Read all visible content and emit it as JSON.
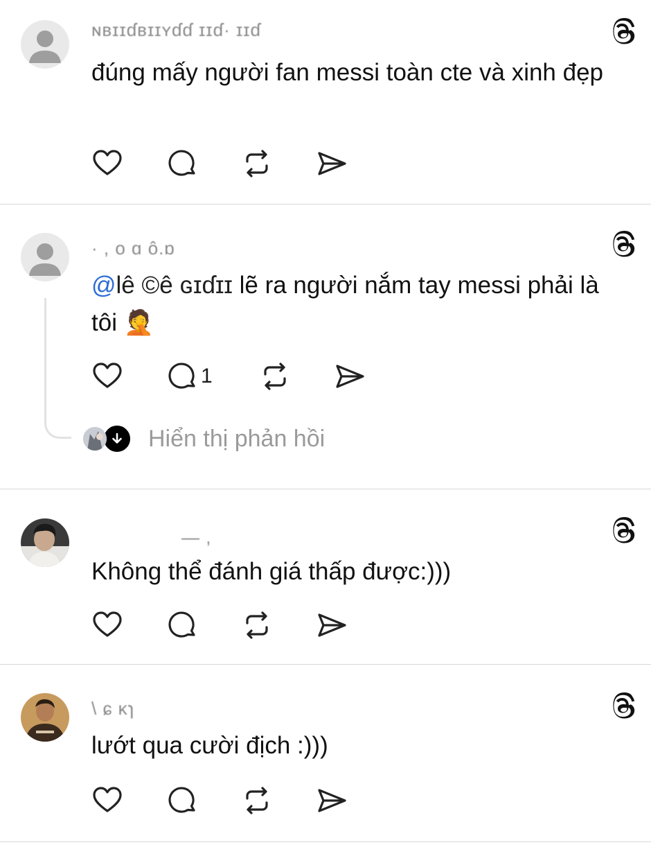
{
  "posts": [
    {
      "username": "ɴʙɪɪɗʙɪɪʏɗɗ   ɪɪɗ·        ɪɪɗ",
      "text": "đúng mấy người fan messi toàn cte và xinh đẹp",
      "avatar": "default-avatar"
    },
    {
      "username": "·  ,    o ɑ      ô.ɒ",
      "mention_at": "@",
      "mention_rest": "lê    ©ê ɢɪɗɪɪ",
      "text_after_mention": " lẽ ra người nắm tay messi phải là tôi 🤦",
      "reply_count": "1",
      "show_replies_label": "Hiển thị phản hồi",
      "avatar": "default-avatar"
    },
    {
      "username": "—   ,",
      "text": "Không thể đánh giá thấp được:)))",
      "avatar": "photo-avatar-dark"
    },
    {
      "username": "\\     ɕ     ĸɿ",
      "text": "lướt qua cười địch :)))",
      "avatar": "photo-avatar-warm"
    }
  ],
  "icons": {
    "like": "heart-icon",
    "comment": "comment-bubble-icon",
    "repost": "repost-icon",
    "share": "send-icon",
    "brand": "threads-logo-icon",
    "expand": "arrow-down-icon"
  },
  "colors": {
    "text": "#111111",
    "muted": "#9a9a9a",
    "divider": "#d8d8d8",
    "mention": "#2b6cd4"
  }
}
